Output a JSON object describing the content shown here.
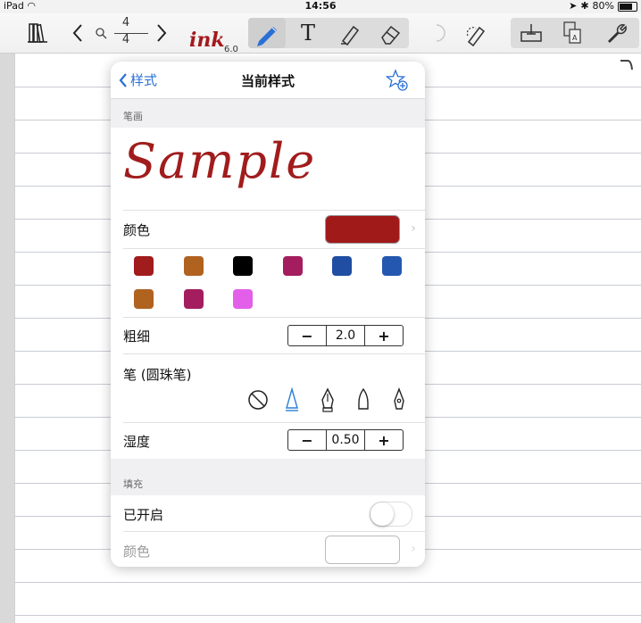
{
  "status": {
    "device": "iPad",
    "time": "14:56",
    "battery": "80%"
  },
  "toolbar": {
    "page_current": "4",
    "page_total": "4",
    "app_logo": "ink",
    "app_version": "6.0",
    "text_tool": "T"
  },
  "popover": {
    "back_label": "样式",
    "title": "当前样式",
    "sections": {
      "stroke": "笔画",
      "fill": "填充"
    },
    "sample_text": "Sample",
    "color_label": "颜色",
    "selected_color": "#a01a1a",
    "palette": [
      "#a11c1c",
      "#b0621f",
      "#000000",
      "#a31d5f",
      "#1f4ea3",
      "#2458b0",
      "#b0621f",
      "#a31d5f",
      "#e35ee9"
    ],
    "thickness": {
      "label": "粗细",
      "value": "2.0",
      "minus": "−",
      "plus": "+"
    },
    "pen": {
      "label": "笔 (圆珠笔)"
    },
    "wetness": {
      "label": "湿度",
      "value": "0.50",
      "minus": "−",
      "plus": "+"
    },
    "fill": {
      "enabled_label": "已开启",
      "color_label": "颜色",
      "enabled": false
    }
  }
}
